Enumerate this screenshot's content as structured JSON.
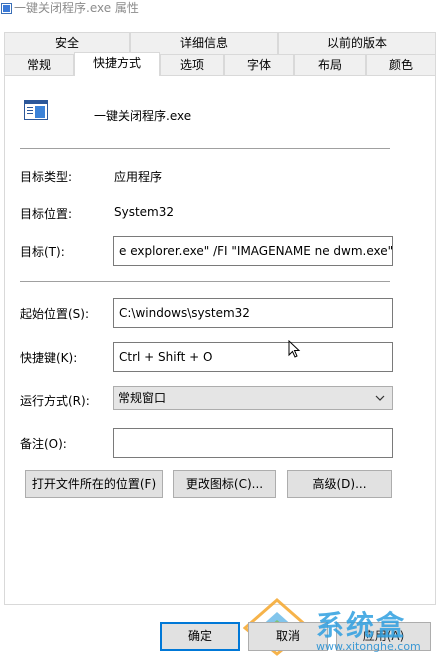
{
  "window": {
    "title": "一键关闭程序.exe 属性"
  },
  "tabs_row1": [
    {
      "label": "安全"
    },
    {
      "label": "详细信息"
    },
    {
      "label": "以前的版本"
    }
  ],
  "tabs_row2": [
    {
      "label": "常规"
    },
    {
      "label": "快捷方式",
      "active": true
    },
    {
      "label": "选项"
    },
    {
      "label": "字体"
    },
    {
      "label": "布局"
    },
    {
      "label": "颜色"
    }
  ],
  "shortcut": {
    "file_name": "一键关闭程序.exe",
    "target_type_label": "目标类型:",
    "target_type_value": "应用程序",
    "target_location_label": "目标位置:",
    "target_location_value": "System32",
    "target_label": "目标(T):",
    "target_value": "e explorer.exe\" /FI \"IMAGENAME ne dwm.exe\"",
    "start_in_label": "起始位置(S):",
    "start_in_value": "C:\\windows\\system32",
    "hotkey_label": "快捷键(K):",
    "hotkey_value": "Ctrl + Shift + O",
    "run_label": "运行方式(R):",
    "run_value": "常规窗口",
    "comment_label": "备注(O):",
    "comment_value": ""
  },
  "buttons": {
    "open_location": "打开文件所在的位置(F)",
    "change_icon": "更改图标(C)...",
    "advanced": "高级(D)...",
    "ok": "确定",
    "cancel": "取消",
    "apply": "应用(A)"
  },
  "watermark": {
    "text": "系统盒",
    "url": "www.xitonghe.com"
  },
  "colors": {
    "accent": "#0078d7",
    "watermark": "#2f9fe0"
  }
}
